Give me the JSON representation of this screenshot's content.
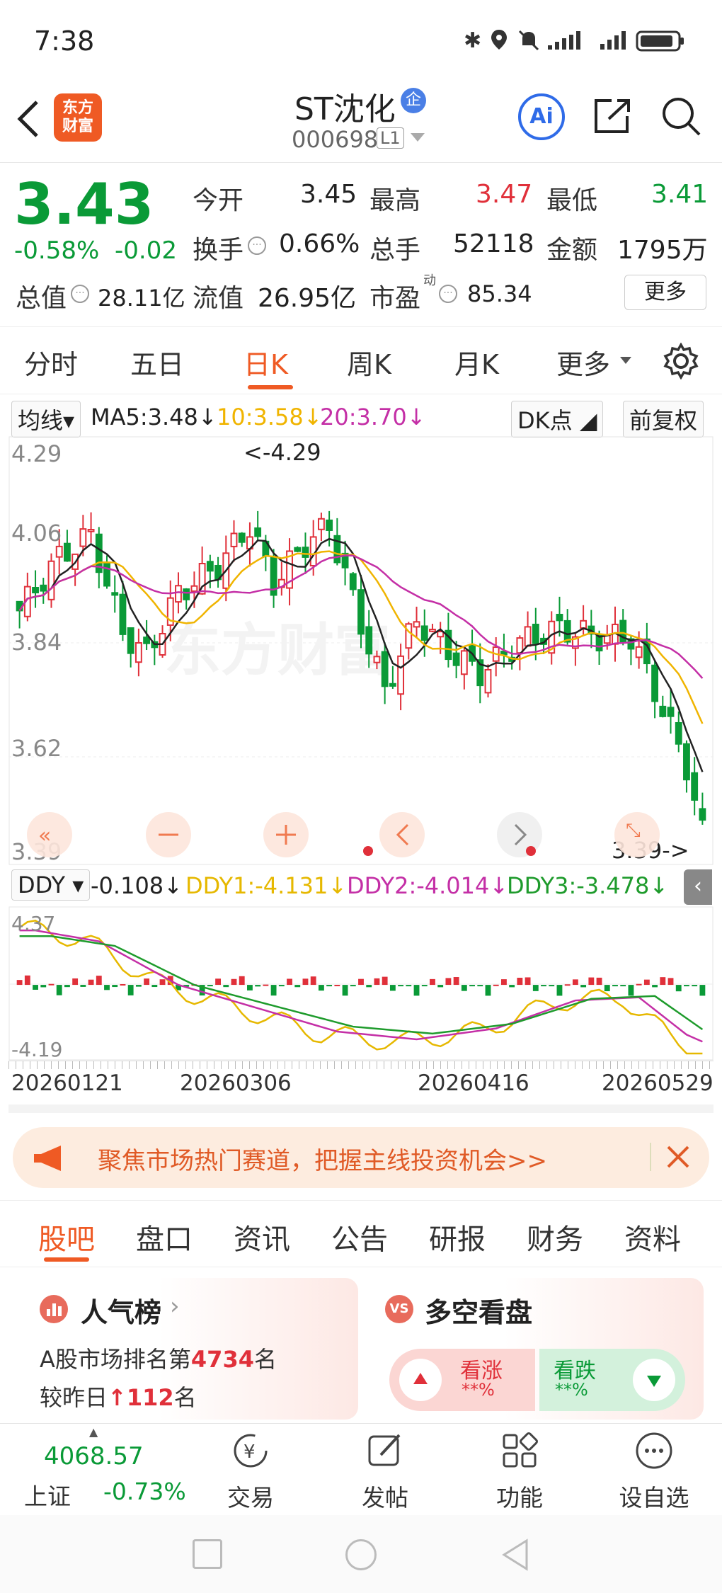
{
  "status": {
    "time": "7:38"
  },
  "header": {
    "name": "ST沈化",
    "badge": "企",
    "code": "000698",
    "level": "L1",
    "logo_line1": "东方",
    "logo_line2": "财富",
    "ai_label": "Ai"
  },
  "quote": {
    "price": "3.43",
    "change_pct": "-0.58%",
    "change": "-0.02",
    "open_label": "今开",
    "open": "3.45",
    "high_label": "最高",
    "high": "3.47",
    "low_label": "最低",
    "low": "3.41",
    "turnover_label": "换手",
    "turnover": "0.66%",
    "volume_label": "总手",
    "volume": "52118",
    "amount_label": "金额",
    "amount": "1795万",
    "mcap_label": "总值",
    "mcap": "28.11亿",
    "float_label": "流值",
    "float": "26.95亿",
    "pe_label": "市盈",
    "pe_sup": "动",
    "pe": "85.34",
    "more": "更多"
  },
  "period_tabs": [
    "分时",
    "五日",
    "日K",
    "周K",
    "月K",
    "更多"
  ],
  "ma": {
    "selector": "均线",
    "ma5": "MA5:3.48↓",
    "ma10": "10:3.58↓",
    "ma20": "20:3.70↓",
    "dk": "DK点",
    "adjust": "前复权",
    "colors": {
      "ma5": "#222222",
      "ma10": "#f0b400",
      "ma20": "#c42fa6"
    }
  },
  "kchart": {
    "y_labels": [
      "4.29",
      "4.06",
      "3.84",
      "3.62",
      "3.39"
    ],
    "hi_note": "<-4.29",
    "lo_note": "3.39->",
    "watermark": "东方财富"
  },
  "ddy": {
    "selector": "DDY",
    "ddy": "-0.108↓",
    "ddy1": "DDY1:-4.131↓",
    "ddy2": "DDY2:-4.014↓",
    "ddy3": "DDY3:-3.478↓",
    "y_top": "4.37",
    "y_bottom": "-4.19",
    "dates": [
      "20260121",
      "20260306",
      "20260416",
      "20260529"
    ]
  },
  "promo": {
    "text": "聚焦市场热门赛道，把握主线投资机会>>"
  },
  "info_tabs": [
    "股吧",
    "盘口",
    "资讯",
    "公告",
    "研报",
    "财务",
    "资料"
  ],
  "popularity": {
    "title": "人气榜",
    "line1_pre": "A股市场排名第",
    "rank": "4734",
    "line1_post": "名",
    "line2_pre": "较昨日",
    "delta": "112",
    "line2_post": "名"
  },
  "bullbear": {
    "title": "多空看盘",
    "up_label": "看涨",
    "up_val": "**%",
    "down_label": "看跌",
    "down_val": "**%",
    "vs": "VS"
  },
  "bottom": {
    "index_value": "4068.57",
    "index_name": "上证",
    "index_change": "-0.73%",
    "trade": "交易",
    "post": "发帖",
    "func": "功能",
    "watch": "设自选"
  }
}
